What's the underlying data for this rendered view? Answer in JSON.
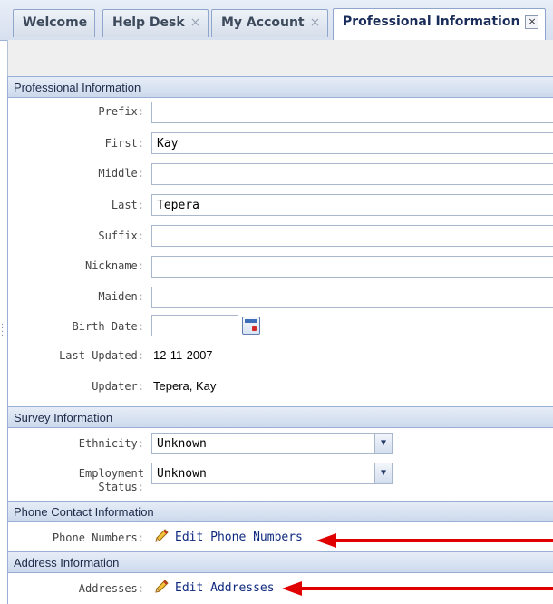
{
  "tabs": [
    {
      "label": "Welcome",
      "closable": false,
      "active": false
    },
    {
      "label": "Help Desk",
      "closable": true,
      "active": false
    },
    {
      "label": "My Account",
      "closable": true,
      "active": false
    },
    {
      "label": "Professional Information",
      "closable": true,
      "active": true
    }
  ],
  "tab_close_glyph": "×",
  "sections": {
    "professional": {
      "title": "Professional Information"
    },
    "survey": {
      "title": "Survey Information"
    },
    "phone": {
      "title": "Phone Contact Information"
    },
    "address": {
      "title": "Address Information"
    }
  },
  "form": {
    "prefix": {
      "label": "Prefix:",
      "value": ""
    },
    "first": {
      "label": "First:",
      "value": "Kay"
    },
    "middle": {
      "label": "Middle:",
      "value": ""
    },
    "last": {
      "label": "Last:",
      "value": "Tepera"
    },
    "suffix": {
      "label": "Suffix:",
      "value": ""
    },
    "nickname": {
      "label": "Nickname:",
      "value": ""
    },
    "maiden": {
      "label": "Maiden:",
      "value": ""
    },
    "birth_date": {
      "label": "Birth Date:",
      "value": ""
    },
    "last_updated": {
      "label": "Last Updated:",
      "value": "12-11-2007"
    },
    "updater": {
      "label": "Updater:",
      "value": "Tepera, Kay"
    }
  },
  "survey": {
    "ethnicity": {
      "label": "Ethnicity:",
      "selected": "Unknown"
    },
    "employment": {
      "label_line1": "Employment",
      "label_line2": "Status:",
      "selected": "Unknown"
    }
  },
  "phone": {
    "label": "Phone Numbers:",
    "link": "Edit Phone Numbers"
  },
  "address": {
    "label": "Addresses:",
    "link": "Edit Addresses"
  },
  "icons": {
    "calendar": "calendar-icon",
    "pencil": "pencil-icon",
    "dropdown": "chevron-down-icon"
  },
  "colors": {
    "annotation_arrow": "#e00000",
    "link": "#102a80",
    "section_header_bg": "#d8e2f1"
  }
}
